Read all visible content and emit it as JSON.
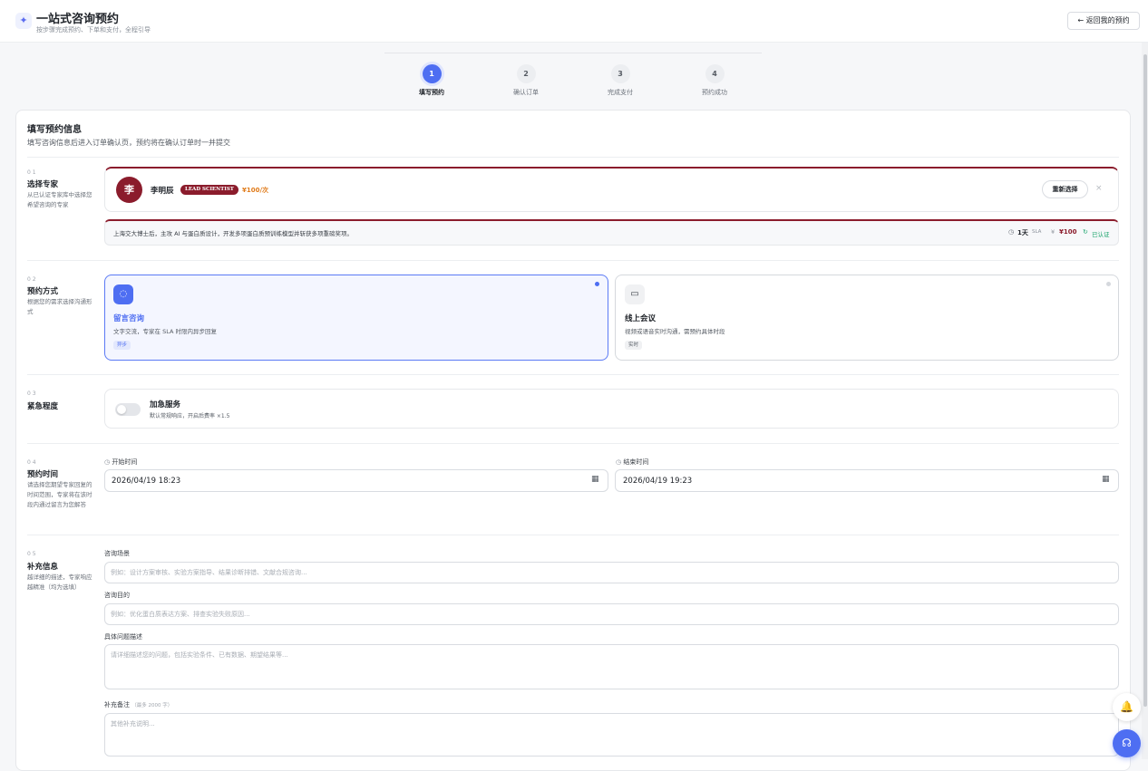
{
  "header": {
    "title": "一站式咨询预约",
    "subtitle": "按步骤完成预约、下单和支付，全程引导",
    "back_label": "← 返回我的预约"
  },
  "steps": [
    {
      "num": "1",
      "label": "填写预约",
      "active": true
    },
    {
      "num": "2",
      "label": "确认订单",
      "active": false
    },
    {
      "num": "3",
      "label": "完成支付",
      "active": false
    },
    {
      "num": "4",
      "label": "预约成功",
      "active": false
    }
  ],
  "form": {
    "title": "填写预约信息",
    "subtitle": "填写咨询信息后进入订单确认页，预约将在确认订单时一并提交"
  },
  "sections": {
    "expert": {
      "no": "0 1",
      "title": "选择专家",
      "desc": "从已认证专家库中选择您希望咨询的专家"
    },
    "mode": {
      "no": "0 2",
      "title": "预约方式",
      "desc": "根据您的需求选择沟通形式"
    },
    "urgency": {
      "no": "0 3",
      "title": "紧急程度"
    },
    "time": {
      "no": "0 4",
      "title": "预约时间",
      "desc": "请选择您期望专家回复的时间范围，专家将在该时段内通过留言为您解答"
    },
    "extra": {
      "no": "0 5",
      "title": "补充信息",
      "desc": "越详细的描述，专家响应越精准（均为选填）"
    }
  },
  "expert": {
    "avatar": "李",
    "name": "李明辰",
    "badge": "LEAD SCIENTIST",
    "price": "¥100/次",
    "reselect_label": "重新选择",
    "clear_icon": "×",
    "bio": "上海交大博士后，主攻 AI 与蛋白质设计，开发多项蛋白质预训练模型并斩获多项重磅奖项。",
    "sla_icon": "◷",
    "sla_value": "1天",
    "sla_label": "SLA",
    "price_symbol": "¥",
    "price_value": "¥100",
    "verified_icon": "↻",
    "verified_label": "已认证"
  },
  "modes": [
    {
      "icon": "chat-bubble-icon",
      "icon_glyph": "◌",
      "title": "留言咨询",
      "desc": "文字交流，专家在 SLA 时限内异步回复",
      "tag": "异步",
      "selected": true
    },
    {
      "icon": "video-icon",
      "icon_glyph": "▭",
      "title": "线上会议",
      "desc": "视频或语音实时沟通，需预约具体时段",
      "tag": "实时",
      "selected": false
    }
  ],
  "urgency": {
    "title": "加急服务",
    "desc": "默认常规响应，开启后费率 ×1.5",
    "enabled": false
  },
  "time": {
    "start_label": "开始时间",
    "start_value": "2026/04/19 18:23",
    "end_label": "结束时间",
    "end_value": "2026/04/19 19:23",
    "clock_icon": "◷",
    "calendar_icon": "▦"
  },
  "extra": {
    "scene_label": "咨询场景",
    "scene_placeholder": "例如：设计方案审核、实验方案指导、结果诊断排错、文献合规咨询...",
    "goal_label": "咨询目的",
    "goal_placeholder": "例如：优化蛋白质表达方案、排查实验失败原因...",
    "detail_label": "具体问题描述",
    "detail_placeholder": "请详细描述您的问题，包括实验条件、已有数据、期望结果等...",
    "note_label": "补充备注",
    "note_hint": "（最多 2000 字）",
    "note_placeholder": "其他补充说明..."
  },
  "float": {
    "bell_glyph": "🔔",
    "help_glyph": "☊"
  },
  "colors": {
    "accent": "#4e6ef2",
    "expert_brand": "#8b1c2c",
    "price_orange": "#e07b1a",
    "verified_green": "#1aa36b"
  }
}
